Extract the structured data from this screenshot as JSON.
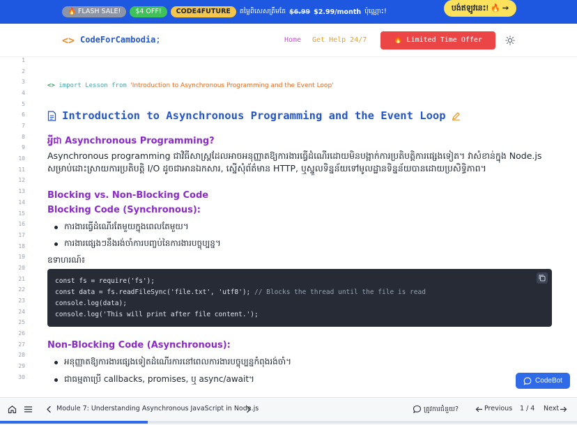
{
  "promo": {
    "flash_sale": "🔥 FLASH SALE!",
    "discount": "$4 OFF!",
    "code": "CODE4FUTURE",
    "limited_text": "តម្លៃពិសេសត្រឹមតែ",
    "old_price": "$6.99",
    "new_price": "$2.99/month",
    "suffix": "ប៉ុណ្ណោះ!",
    "claim_label": "បង់ឥឡូវនេះ! 🔥 ➙"
  },
  "navbar": {
    "logo_text": "CodeForCambodia",
    "logo_suffix": ";",
    "home": "Home",
    "help": "Get Help 24/7",
    "offer": "🔥 Limited Time Offer",
    "icons": {
      "logo": "code-brackets-icon",
      "theme": "sun-icon"
    }
  },
  "line_numbers": [
    "1",
    "2",
    "3",
    "4",
    "5",
    "6",
    "7",
    "8",
    "9",
    "10",
    "11",
    "12",
    "13",
    "14",
    "15",
    "16",
    "17",
    "18",
    "19",
    "20",
    "21",
    "22",
    "23",
    "24",
    "25",
    "26",
    "27",
    "28",
    "29",
    "30"
  ],
  "lesson": {
    "import_glyph": "<>",
    "import_kw": "import",
    "import_name": "Lesson",
    "from_kw": "from",
    "import_source": "'Introduction to Asynchronous Programming and the Event Loop'",
    "title": "Introduction to Asynchronous Programming and the Event Loop",
    "h_what": "អ្វីជា Asynchronous Programming?",
    "para_what": "Asynchronous programming ជាវិធីសាស្ត្រដែលអាចអនុញ្ញាតឱ្យការងារធ្វើដំណើរដោយមិនបង្អាក់ការប្រតិបត្តិការផ្សេងទៀត។ វាសំខាន់ក្នុង Node.js សម្រាប់ដោះស្រាយការប្រតិបត្តិ I/O ដូចជាអានឯកសារ, ស្នើសុំព័ត៌មាន HTTP, ឬស្នួលទិន្នន័យទៅមូលដ្ឋានទិន្នន័យបានដោយប្រសិទ្ធិភាព។",
    "h_blocking": "Blocking vs. Non-Blocking Code",
    "h_sync": "Blocking Code (Synchronous):",
    "sync_bullets": [
      "ការងារធ្វើដំណើរតែមួយក្នុងពេលតែមួយ។",
      "ការងារផ្សេងៗនឹងរង់ចាំការបញ្ចប់នៃការងារបច្ចុប្បន្ន។"
    ],
    "example_label": "ឧទាហរណ៍៖",
    "code_lines": [
      "const fs = require('fs');",
      "const data = fs.readFileSync('file.txt', 'utf8');",
      "console.log(data);",
      "console.log('This will print after file content.');"
    ],
    "code_comment": " // Blocks the thread until the file is read",
    "h_async": "Non-Blocking Code (Asynchronous):",
    "async_bullets": [
      "អនុញ្ញាតឱ្យការងារផ្សេងទៀតដំណើរការនៅពេលការងារបច្ចុប្បន្នកំពុងរង់ចាំ។",
      "ជាធម្មតាប្រើ callbacks, promises, ឬ async/await។"
    ]
  },
  "codebot": {
    "label": "CodeBot"
  },
  "footer": {
    "module_title": "Module 7: Understanding Asynchronous JavaScript in Node.js",
    "help_label": "ត្រូវការជំនួយ?",
    "previous": "Previous",
    "page_indicator": "1 / 4",
    "next": "Next",
    "progress": 0.256
  },
  "colors": {
    "banner": "#1f58e0",
    "accent": "#2456c9",
    "heading": "#8a2bc9",
    "offer": "#ec4545",
    "code_bg": "#262b36"
  }
}
